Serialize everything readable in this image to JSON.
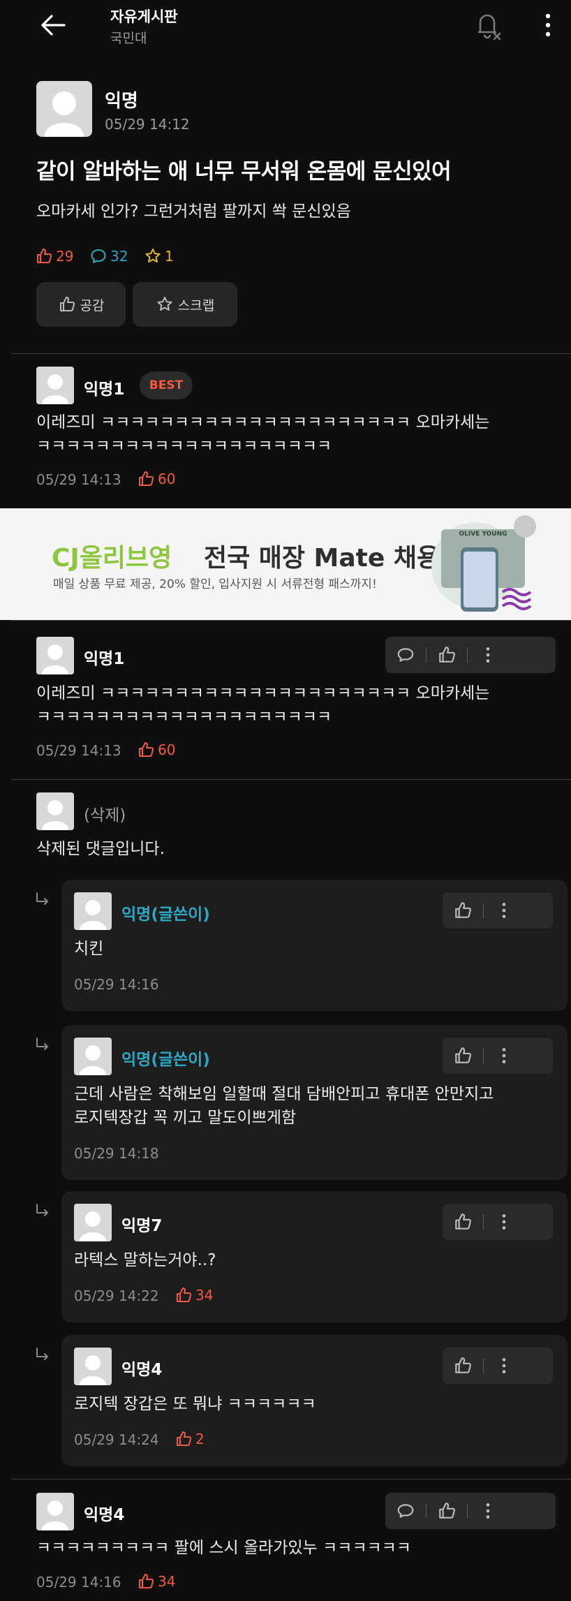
{
  "header": {
    "title": "자유게시판",
    "subtitle": "국민대"
  },
  "post": {
    "author": "익명",
    "time": "05/29 14:12",
    "title": "같이 알바하는 애 너무 무서워 온몸에 문신있어",
    "body": "오마카세 인가? 그런거처럼 팔까지 쏵 문신있음",
    "likes": "29",
    "comments": "32",
    "scraps": "1",
    "like_button": "공감",
    "scrap_button": "스크랩"
  },
  "best_comment": {
    "author": "익명1",
    "badge": "BEST",
    "line1": "이레즈미 ㅋㅋㅋㅋㅋㅋㅋㅋㅋㅋㅋㅋㅋㅋㅋㅋㅋㅋㅋㅋㅋ 오마카세는",
    "line2": "ㅋㅋㅋㅋㅋㅋㅋㅋㅋㅋㅋㅋㅋㅋㅋㅋㅋㅋㅋㅋ",
    "time": "05/29 14:13",
    "likes": "60"
  },
  "ad": {
    "brand": "CJ올리브영",
    "headline": "전국 매장 Mate 채용",
    "subtext": "매일 상품 무료 제공, 20% 할인, 입사지원 시 서류전형 패스까지!",
    "logo_text": "OLIVE YOUNG"
  },
  "comments": [
    {
      "author": "익명1",
      "line1": "이레즈미 ㅋㅋㅋㅋㅋㅋㅋㅋㅋㅋㅋㅋㅋㅋㅋㅋㅋㅋㅋㅋㅋ 오마카세는",
      "line2": "ㅋㅋㅋㅋㅋㅋㅋㅋㅋㅋㅋㅋㅋㅋㅋㅋㅋㅋㅋㅋ",
      "time": "05/29 14:13",
      "likes": "60"
    },
    {
      "author": "(삭제)",
      "text": "삭제된 댓글입니다."
    },
    {
      "author": "익명4",
      "text": "ㅋㅋㅋㅋㅋㅋㅋㅋㅋ 팔에 스시 올라가있누 ㅋㅋㅋㅋㅋㅋ",
      "time": "05/29 14:16",
      "likes": "34"
    }
  ],
  "replies": [
    {
      "author": "익명(글쓴이)",
      "text": "치킨",
      "time": "05/29 14:16"
    },
    {
      "author": "익명(글쓴이)",
      "line1": "근데 사람은 착해보임 일할때 절대 담배안피고 휴대폰 안만지고",
      "line2": "로지텍장갑 꼭 끼고 말도이쁘게함",
      "time": "05/29 14:18"
    },
    {
      "author": "익명7",
      "text": "라텍스 말하는거야..?",
      "time": "05/29 14:22",
      "likes": "34"
    },
    {
      "author": "익명4",
      "text": "로지텍 장갑은 또 뭐냐 ㅋㅋㅋㅋㅋㅋ",
      "time": "05/29 14:24",
      "likes": "2"
    }
  ],
  "colors": {
    "background": "#0e0e0e",
    "accent_red": "#f25a44",
    "author_teal": "#2aa8c4",
    "star_yellow": "#e4b62c",
    "ad_green": "#8dc63f"
  },
  "icons": [
    "back-arrow-icon",
    "bell-off-icon",
    "more-vertical-icon",
    "thumbs-up-icon",
    "speech-bubble-icon",
    "star-icon",
    "reply-arrow-icon",
    "avatar-icon"
  ]
}
